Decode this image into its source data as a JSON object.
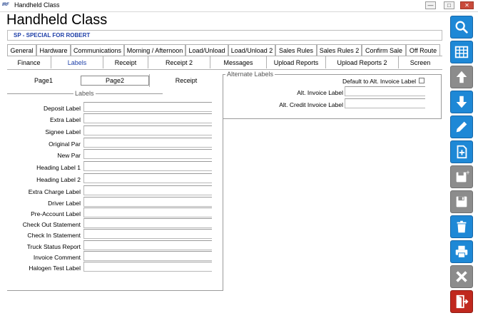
{
  "window": {
    "title": "Handheld Class",
    "app_icon": "IRF",
    "controls": {
      "minimize": "—",
      "maximize": "□",
      "close": "✕"
    }
  },
  "page_title": "Handheld Class",
  "company": "SP - SPECIAL FOR  ROBERT",
  "tabs_row1": [
    "General",
    "Hardware",
    "Communications",
    "Morning / Afternoon",
    "Load/Unload",
    "Load/Unload 2",
    "Sales Rules",
    "Sales Rules 2",
    "Confirm Sale",
    "Off Route"
  ],
  "tabs_row2": [
    "Finance",
    "Labels",
    "Receipt",
    "Receipt 2",
    "Messages",
    "Upload Reports",
    "Upload Reports 2",
    "Screen"
  ],
  "tabs_row2_active": "Labels",
  "subtabs": [
    "Page1",
    "Page2",
    "Receipt"
  ],
  "subtab_selected": "Page2",
  "labels_group": {
    "title": "Labels",
    "fields": [
      {
        "label": "Deposit Label",
        "value": ""
      },
      {
        "label": "Extra Label",
        "value": ""
      },
      {
        "label": "Signee Label",
        "value": ""
      },
      {
        "label": "Original Par",
        "value": ""
      },
      {
        "label": "New Par",
        "value": ""
      },
      {
        "label": "Heading Label 1",
        "value": ""
      },
      {
        "label": "Heading Label 2",
        "value": ""
      },
      {
        "label": "Extra Charge Label",
        "value": ""
      },
      {
        "label": "Driver Label",
        "value": ""
      },
      {
        "label": "Pre-Account Label",
        "value": ""
      },
      {
        "label": "Check Out Statement",
        "value": ""
      },
      {
        "label": "Check In Statement",
        "value": ""
      },
      {
        "label": "Truck Status Report",
        "value": ""
      },
      {
        "label": "Invoice Comment",
        "value": ""
      },
      {
        "label": "Halogen Test Label",
        "value": ""
      }
    ]
  },
  "alternate_group": {
    "title": "Alternate Labels",
    "default_checkbox_label": "Default to Alt. Invoice Label",
    "default_checked": false,
    "fields": [
      {
        "label": "Alt. Invoice Label",
        "value": ""
      },
      {
        "label": "Alt. Credit Invoice Label",
        "value": ""
      }
    ]
  },
  "sidebar_buttons": [
    {
      "name": "search-icon",
      "color": "#1e88d6"
    },
    {
      "name": "grid-icon",
      "color": "#1e88d6"
    },
    {
      "name": "arrow-up-icon",
      "color": "#8c8c8c"
    },
    {
      "name": "arrow-down-icon",
      "color": "#1e88d6"
    },
    {
      "name": "edit-icon",
      "color": "#1e88d6"
    },
    {
      "name": "new-document-icon",
      "color": "#1e88d6"
    },
    {
      "name": "save-new-icon",
      "color": "#8c8c8c"
    },
    {
      "name": "save-icon",
      "color": "#8c8c8c"
    },
    {
      "name": "trash-icon",
      "color": "#1e88d6"
    },
    {
      "name": "print-icon",
      "color": "#1e88d6"
    },
    {
      "name": "cancel-icon",
      "color": "#8c8c8c"
    },
    {
      "name": "exit-icon",
      "color": "#c0281e"
    }
  ]
}
